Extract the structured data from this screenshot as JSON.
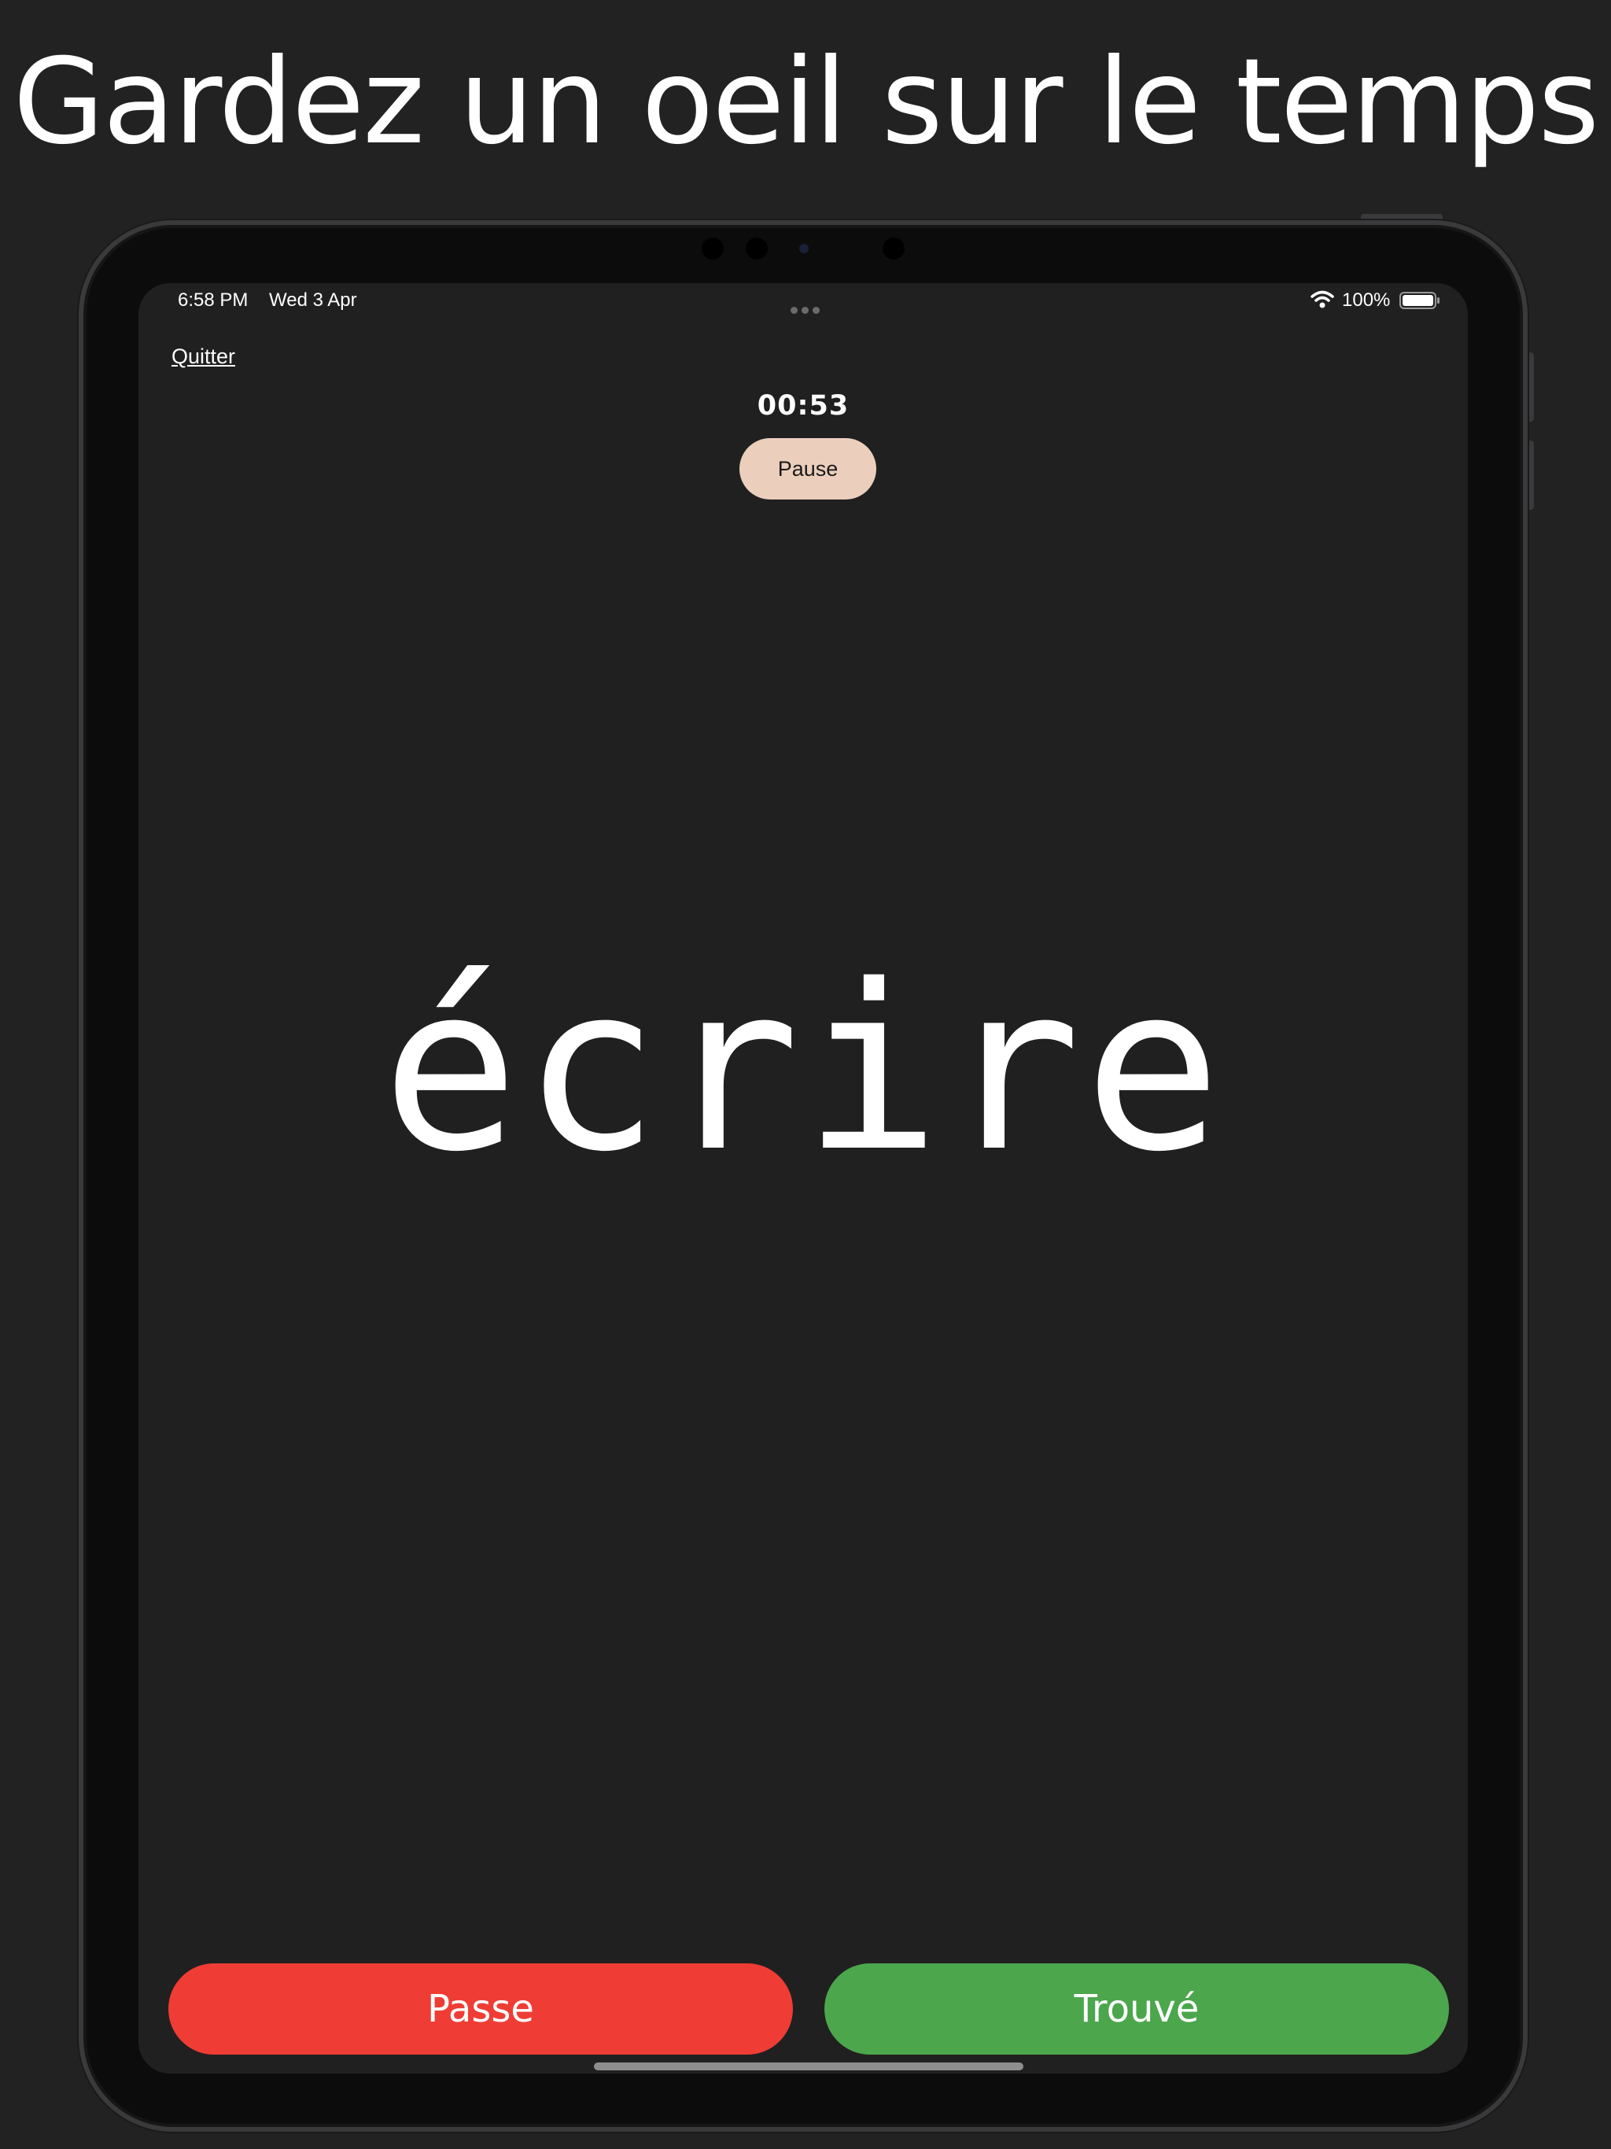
{
  "headline": "Gardez un oeil sur le temps",
  "status_bar": {
    "time": "6:58 PM",
    "date": "Wed 3 Apr",
    "battery_percent": "100%",
    "battery_level": 1.0
  },
  "game": {
    "quit_label": "Quitter",
    "timer": "00:53",
    "pause_label": "Pause",
    "word": "écrire",
    "pass_label": "Passe",
    "found_label": "Trouvé"
  },
  "colors": {
    "background": "#222222",
    "screen": "#202020",
    "pause_button": "#ebcfbc",
    "pass_button": "#ef3d35",
    "found_button": "#4ca64c"
  },
  "icons": {
    "wifi": "wifi-icon",
    "battery": "battery-icon",
    "multitask_dots": "ellipsis-icon"
  }
}
